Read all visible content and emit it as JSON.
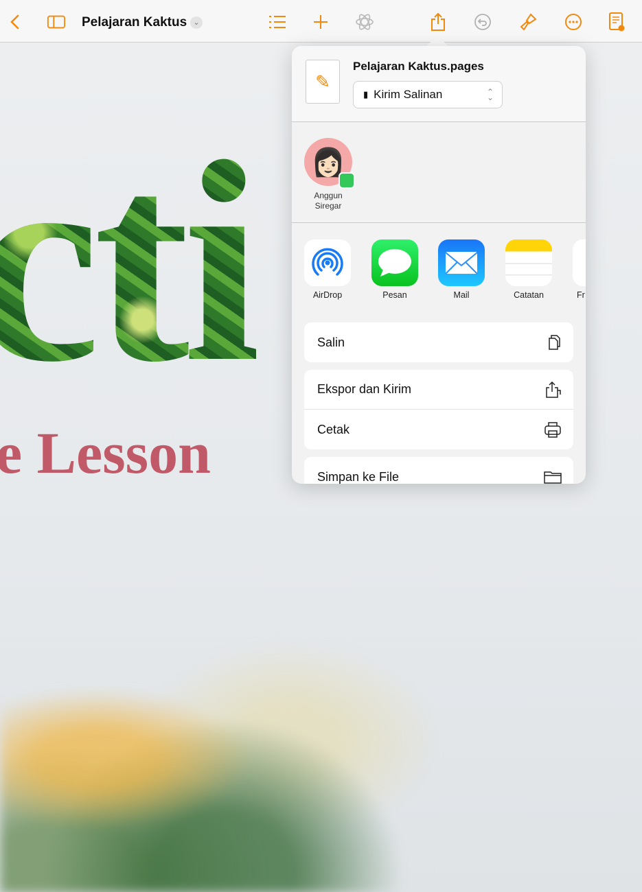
{
  "toolbar": {
    "title": "Pelajaran Kaktus",
    "icons": [
      "chevron-left-icon",
      "sidebar-icon",
      "list-icon",
      "plus-icon",
      "animate-icon",
      "share-icon",
      "undo-icon",
      "paintbrush-icon",
      "more-icon",
      "reader-icon"
    ]
  },
  "document": {
    "big_text": "cti",
    "subtitle": "e Lesson"
  },
  "share": {
    "file_name": "Pelajaran Kaktus.pages",
    "send_option": "Kirim Salinan",
    "person": {
      "name": "Anggun Siregar"
    },
    "apps": [
      {
        "label": "AirDrop"
      },
      {
        "label": "Pesan"
      },
      {
        "label": "Mail"
      },
      {
        "label": "Catatan"
      },
      {
        "label": "Fr"
      }
    ],
    "actions": [
      {
        "label": "Salin"
      },
      {
        "label": "Ekspor dan Kirim"
      },
      {
        "label": "Cetak"
      },
      {
        "label": "Simpan ke File"
      }
    ]
  },
  "colors": {
    "accent": "#f2890d",
    "lesson": "#c05a68"
  }
}
